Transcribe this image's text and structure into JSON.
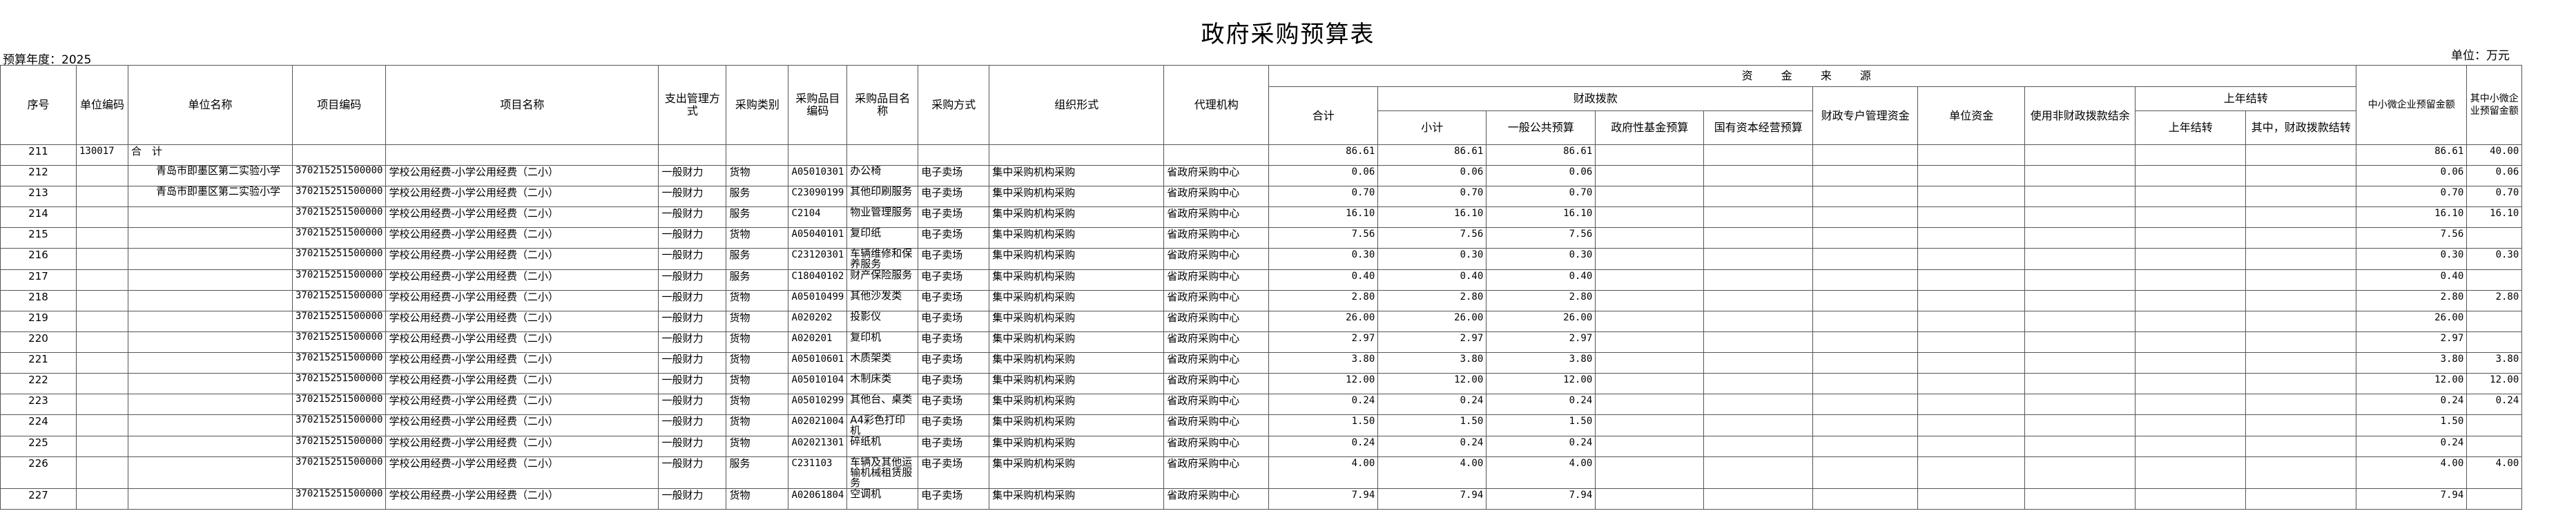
{
  "title": "政府采购预算表",
  "budget_year_label": "预算年度：2025",
  "unit_label": "单位：万元",
  "headers": {
    "seq": "序号",
    "unit_code": "单位编码",
    "unit_name": "单位名称",
    "project_code": "项目编码",
    "project_name": "项目名称",
    "expense_mode": "支出管理方式",
    "category": "采购类别",
    "item_code": "采购品目编码",
    "item_name": "采购品目名称",
    "method": "采购方式",
    "org_form": "组织形式",
    "agency": "代理机构",
    "funding_source": "资 金 来 源",
    "total": "合计",
    "fiscal": "财政拨款",
    "subtotal": "小计",
    "general_budget": "一般公共预算",
    "gov_fund": "政府性基金预算",
    "state_capital": "国有资本经营预算",
    "special_account": "财政专户管理资金",
    "unit_fund": "单位资金",
    "non_fiscal_balance": "使用非财政拨款结余",
    "prior_balance": "上年结转",
    "prior_carry": "上年结转",
    "prior_fiscal_carry": "其中，财政拨款结转",
    "sme_reserved": "中小微企业预留金额",
    "sme_reserved_2": "其中小微企业预留金额"
  },
  "rows": [
    {
      "seq": "211",
      "unit_code": "130017",
      "unit_name": "合　计",
      "project_code": "",
      "project_name": "",
      "mode": "",
      "cat": "",
      "item_code": "",
      "item_name": "",
      "method": "",
      "org": "",
      "agency": "",
      "total": "86.61",
      "sub": "86.61",
      "gen": "86.61",
      "sme": "86.61",
      "sme2": "40.00"
    },
    {
      "seq": "212",
      "unit_code": "",
      "unit_name": "青岛市即墨区第二实验小学",
      "project_code": "370215251500000",
      "project_name": "学校公用经费-小学公用经费（二小）",
      "mode": "一般财力",
      "cat": "货物",
      "item_code": "A05010301",
      "item_name": "办公椅",
      "method": "电子卖场",
      "org": "集中采购机构采购",
      "agency": "省政府采购中心",
      "total": "0.06",
      "sub": "0.06",
      "gen": "0.06",
      "sme": "0.06",
      "sme2": "0.06"
    },
    {
      "seq": "213",
      "unit_code": "",
      "unit_name": "青岛市即墨区第二实验小学",
      "project_code": "370215251500000",
      "project_name": "学校公用经费-小学公用经费（二小）",
      "mode": "一般财力",
      "cat": "服务",
      "item_code": "C23090199",
      "item_name": "其他印刷服务",
      "method": "电子卖场",
      "org": "集中采购机构采购",
      "agency": "省政府采购中心",
      "total": "0.70",
      "sub": "0.70",
      "gen": "0.70",
      "sme": "0.70",
      "sme2": "0.70"
    },
    {
      "seq": "214",
      "unit_code": "",
      "unit_name": "",
      "project_code": "370215251500000",
      "project_name": "学校公用经费-小学公用经费（二小）",
      "mode": "一般财力",
      "cat": "服务",
      "item_code": "C2104",
      "item_name": "物业管理服务",
      "method": "电子卖场",
      "org": "集中采购机构采购",
      "agency": "省政府采购中心",
      "total": "16.10",
      "sub": "16.10",
      "gen": "16.10",
      "sme": "16.10",
      "sme2": "16.10"
    },
    {
      "seq": "215",
      "unit_code": "",
      "unit_name": "",
      "project_code": "370215251500000",
      "project_name": "学校公用经费-小学公用经费（二小）",
      "mode": "一般财力",
      "cat": "货物",
      "item_code": "A05040101",
      "item_name": "复印纸",
      "method": "电子卖场",
      "org": "集中采购机构采购",
      "agency": "省政府采购中心",
      "total": "7.56",
      "sub": "7.56",
      "gen": "7.56",
      "sme": "7.56",
      "sme2": ""
    },
    {
      "seq": "216",
      "unit_code": "",
      "unit_name": "",
      "project_code": "370215251500000",
      "project_name": "学校公用经费-小学公用经费（二小）",
      "mode": "一般财力",
      "cat": "服务",
      "item_code": "C23120301",
      "item_name": "车辆维修和保养服务",
      "method": "电子卖场",
      "org": "集中采购机构采购",
      "agency": "省政府采购中心",
      "total": "0.30",
      "sub": "0.30",
      "gen": "0.30",
      "sme": "0.30",
      "sme2": "0.30"
    },
    {
      "seq": "217",
      "unit_code": "",
      "unit_name": "",
      "project_code": "370215251500000",
      "project_name": "学校公用经费-小学公用经费（二小）",
      "mode": "一般财力",
      "cat": "服务",
      "item_code": "C18040102",
      "item_name": "财产保险服务",
      "method": "电子卖场",
      "org": "集中采购机构采购",
      "agency": "省政府采购中心",
      "total": "0.40",
      "sub": "0.40",
      "gen": "0.40",
      "sme": "0.40",
      "sme2": ""
    },
    {
      "seq": "218",
      "unit_code": "",
      "unit_name": "",
      "project_code": "370215251500000",
      "project_name": "学校公用经费-小学公用经费（二小）",
      "mode": "一般财力",
      "cat": "货物",
      "item_code": "A05010499",
      "item_name": "其他沙发类",
      "method": "电子卖场",
      "org": "集中采购机构采购",
      "agency": "省政府采购中心",
      "total": "2.80",
      "sub": "2.80",
      "gen": "2.80",
      "sme": "2.80",
      "sme2": "2.80"
    },
    {
      "seq": "219",
      "unit_code": "",
      "unit_name": "",
      "project_code": "370215251500000",
      "project_name": "学校公用经费-小学公用经费（二小）",
      "mode": "一般财力",
      "cat": "货物",
      "item_code": "A020202",
      "item_name": "投影仪",
      "method": "电子卖场",
      "org": "集中采购机构采购",
      "agency": "省政府采购中心",
      "total": "26.00",
      "sub": "26.00",
      "gen": "26.00",
      "sme": "26.00",
      "sme2": ""
    },
    {
      "seq": "220",
      "unit_code": "",
      "unit_name": "",
      "project_code": "370215251500000",
      "project_name": "学校公用经费-小学公用经费（二小）",
      "mode": "一般财力",
      "cat": "货物",
      "item_code": "A020201",
      "item_name": "复印机",
      "method": "电子卖场",
      "org": "集中采购机构采购",
      "agency": "省政府采购中心",
      "total": "2.97",
      "sub": "2.97",
      "gen": "2.97",
      "sme": "2.97",
      "sme2": ""
    },
    {
      "seq": "221",
      "unit_code": "",
      "unit_name": "",
      "project_code": "370215251500000",
      "project_name": "学校公用经费-小学公用经费（二小）",
      "mode": "一般财力",
      "cat": "货物",
      "item_code": "A05010601",
      "item_name": "木质架类",
      "method": "电子卖场",
      "org": "集中采购机构采购",
      "agency": "省政府采购中心",
      "total": "3.80",
      "sub": "3.80",
      "gen": "3.80",
      "sme": "3.80",
      "sme2": "3.80"
    },
    {
      "seq": "222",
      "unit_code": "",
      "unit_name": "",
      "project_code": "370215251500000",
      "project_name": "学校公用经费-小学公用经费（二小）",
      "mode": "一般财力",
      "cat": "货物",
      "item_code": "A05010104",
      "item_name": "木制床类",
      "method": "电子卖场",
      "org": "集中采购机构采购",
      "agency": "省政府采购中心",
      "total": "12.00",
      "sub": "12.00",
      "gen": "12.00",
      "sme": "12.00",
      "sme2": "12.00"
    },
    {
      "seq": "223",
      "unit_code": "",
      "unit_name": "",
      "project_code": "370215251500000",
      "project_name": "学校公用经费-小学公用经费（二小）",
      "mode": "一般财力",
      "cat": "货物",
      "item_code": "A05010299",
      "item_name": "其他台、桌类",
      "method": "电子卖场",
      "org": "集中采购机构采购",
      "agency": "省政府采购中心",
      "total": "0.24",
      "sub": "0.24",
      "gen": "0.24",
      "sme": "0.24",
      "sme2": "0.24"
    },
    {
      "seq": "224",
      "unit_code": "",
      "unit_name": "",
      "project_code": "370215251500000",
      "project_name": "学校公用经费-小学公用经费（二小）",
      "mode": "一般财力",
      "cat": "货物",
      "item_code": "A02021004",
      "item_name": "A4彩色打印机",
      "method": "电子卖场",
      "org": "集中采购机构采购",
      "agency": "省政府采购中心",
      "total": "1.50",
      "sub": "1.50",
      "gen": "1.50",
      "sme": "1.50",
      "sme2": ""
    },
    {
      "seq": "225",
      "unit_code": "",
      "unit_name": "",
      "project_code": "370215251500000",
      "project_name": "学校公用经费-小学公用经费（二小）",
      "mode": "一般财力",
      "cat": "货物",
      "item_code": "A02021301",
      "item_name": "碎纸机",
      "method": "电子卖场",
      "org": "集中采购机构采购",
      "agency": "省政府采购中心",
      "total": "0.24",
      "sub": "0.24",
      "gen": "0.24",
      "sme": "0.24",
      "sme2": ""
    },
    {
      "seq": "226",
      "unit_code": "",
      "unit_name": "",
      "project_code": "370215251500000",
      "project_name": "学校公用经费-小学公用经费（二小）",
      "mode": "一般财力",
      "cat": "服务",
      "item_code": "C231103",
      "item_name": "车辆及其他运输机械租赁服务",
      "method": "电子卖场",
      "org": "集中采购机构采购",
      "agency": "省政府采购中心",
      "total": "4.00",
      "sub": "4.00",
      "gen": "4.00",
      "sme": "4.00",
      "sme2": "4.00"
    },
    {
      "seq": "227",
      "unit_code": "",
      "unit_name": "",
      "project_code": "370215251500000",
      "project_name": "学校公用经费-小学公用经费（二小）",
      "mode": "一般财力",
      "cat": "货物",
      "item_code": "A02061804",
      "item_name": "空调机",
      "method": "电子卖场",
      "org": "集中采购机构采购",
      "agency": "省政府采购中心",
      "total": "7.94",
      "sub": "7.94",
      "gen": "7.94",
      "sme": "7.94",
      "sme2": ""
    }
  ]
}
